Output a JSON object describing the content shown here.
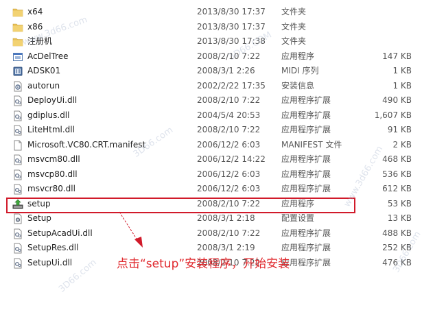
{
  "files": [
    {
      "icon": "folder-icon",
      "name": "x64",
      "date": "2013/8/30 17:37",
      "type": "文件夹",
      "size": ""
    },
    {
      "icon": "folder-icon",
      "name": "x86",
      "date": "2013/8/30 17:37",
      "type": "文件夹",
      "size": ""
    },
    {
      "icon": "folder-icon",
      "name": "注册机",
      "date": "2013/8/30 17:38",
      "type": "文件夹",
      "size": ""
    },
    {
      "icon": "application-icon",
      "name": "AcDelTree",
      "date": "2008/2/10 7:22",
      "type": "应用程序",
      "size": "147 KB"
    },
    {
      "icon": "midi-file-icon",
      "name": "ADSK01",
      "date": "2008/3/1 2:26",
      "type": "MIDI 序列",
      "size": "1 KB"
    },
    {
      "icon": "setup-info-icon",
      "name": "autorun",
      "date": "2002/2/22 17:35",
      "type": "安装信息",
      "size": "1 KB"
    },
    {
      "icon": "dll-file-icon",
      "name": "DeployUi.dll",
      "date": "2008/2/10 7:22",
      "type": "应用程序扩展",
      "size": "490 KB"
    },
    {
      "icon": "dll-file-icon",
      "name": "gdiplus.dll",
      "date": "2004/5/4 20:53",
      "type": "应用程序扩展",
      "size": "1,607 KB"
    },
    {
      "icon": "dll-file-icon",
      "name": "LiteHtml.dll",
      "date": "2008/2/10 7:22",
      "type": "应用程序扩展",
      "size": "91 KB"
    },
    {
      "icon": "blank-file-icon",
      "name": "Microsoft.VC80.CRT.manifest",
      "date": "2006/12/2 6:03",
      "type": "MANIFEST 文件",
      "size": "2 KB"
    },
    {
      "icon": "dll-file-icon",
      "name": "msvcm80.dll",
      "date": "2006/12/2 14:22",
      "type": "应用程序扩展",
      "size": "468 KB"
    },
    {
      "icon": "dll-file-icon",
      "name": "msvcp80.dll",
      "date": "2006/12/2 6:03",
      "type": "应用程序扩展",
      "size": "536 KB"
    },
    {
      "icon": "dll-file-icon",
      "name": "msvcr80.dll",
      "date": "2006/12/2 6:03",
      "type": "应用程序扩展",
      "size": "612 KB"
    },
    {
      "icon": "setup-exe-icon",
      "name": "setup",
      "date": "2008/2/10 7:22",
      "type": "应用程序",
      "size": "53 KB"
    },
    {
      "icon": "config-file-icon",
      "name": "Setup",
      "date": "2008/3/1 2:18",
      "type": "配置设置",
      "size": "13 KB"
    },
    {
      "icon": "dll-file-icon",
      "name": "SetupAcadUi.dll",
      "date": "2008/2/10 7:22",
      "type": "应用程序扩展",
      "size": "488 KB"
    },
    {
      "icon": "dll-file-icon",
      "name": "SetupRes.dll",
      "date": "2008/3/1 2:19",
      "type": "应用程序扩展",
      "size": "252 KB"
    },
    {
      "icon": "dll-file-icon",
      "name": "SetupUi.dll",
      "date": "2008/2/10 7:22",
      "type": "应用程序扩展",
      "size": "476 KB"
    }
  ],
  "annotation": "点击“setup”安装程序，开始安装",
  "colors": {
    "annotation": "#e0292e",
    "highlight": "#d11a2a",
    "folder": "#e8c056"
  }
}
